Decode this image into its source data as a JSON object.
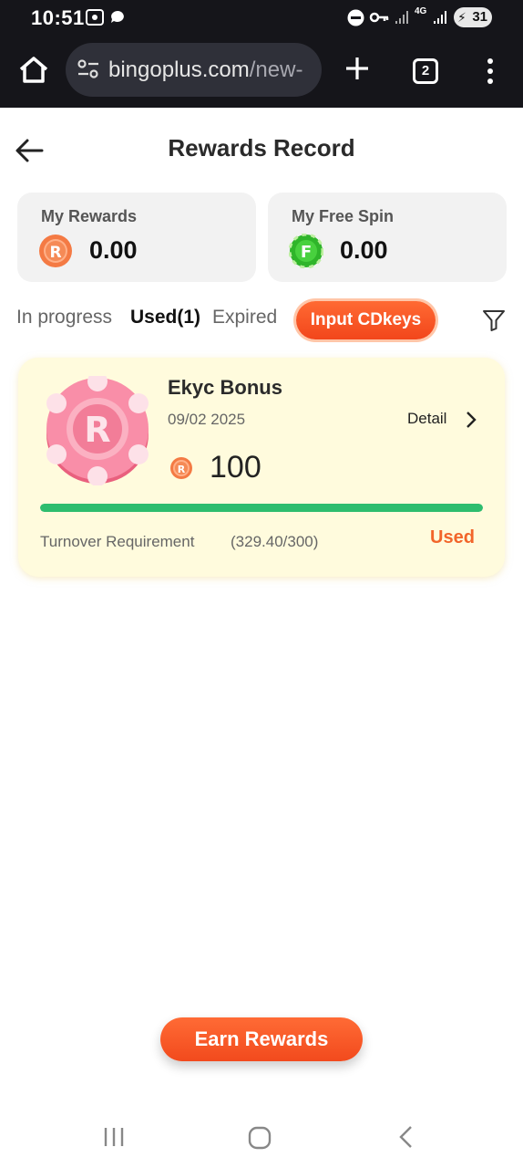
{
  "status_bar": {
    "time": "10:51",
    "network": "4G",
    "battery": "31"
  },
  "browser": {
    "url_host": "bingoplus.com",
    "url_path": "/new-",
    "tab_count": "2"
  },
  "header": {
    "title": "Rewards Record"
  },
  "summary": [
    {
      "label": "My Rewards",
      "value": "0.00",
      "coin_letter": "R"
    },
    {
      "label": "My Free Spin",
      "value": "0.00",
      "coin_letter": "F"
    }
  ],
  "tabs": [
    {
      "label": "In progress",
      "active": false
    },
    {
      "label": "Used(1)",
      "active": true
    },
    {
      "label": "Expired",
      "active": false
    }
  ],
  "cdkey_button": "Input CDkeys",
  "reward": {
    "title": "Ekyc Bonus",
    "date": "09/02 2025",
    "detail_label": "Detail",
    "amount": "100",
    "progress_fraction": 1.0,
    "turnover_label": "Turnover Requirement",
    "turnover_value": "(329.40/300)",
    "status": "Used"
  },
  "earn_button": "Earn Rewards",
  "colors": {
    "accent": "#f2652a",
    "progress": "#2dbd6e",
    "card_bg": "#fffbdd"
  }
}
